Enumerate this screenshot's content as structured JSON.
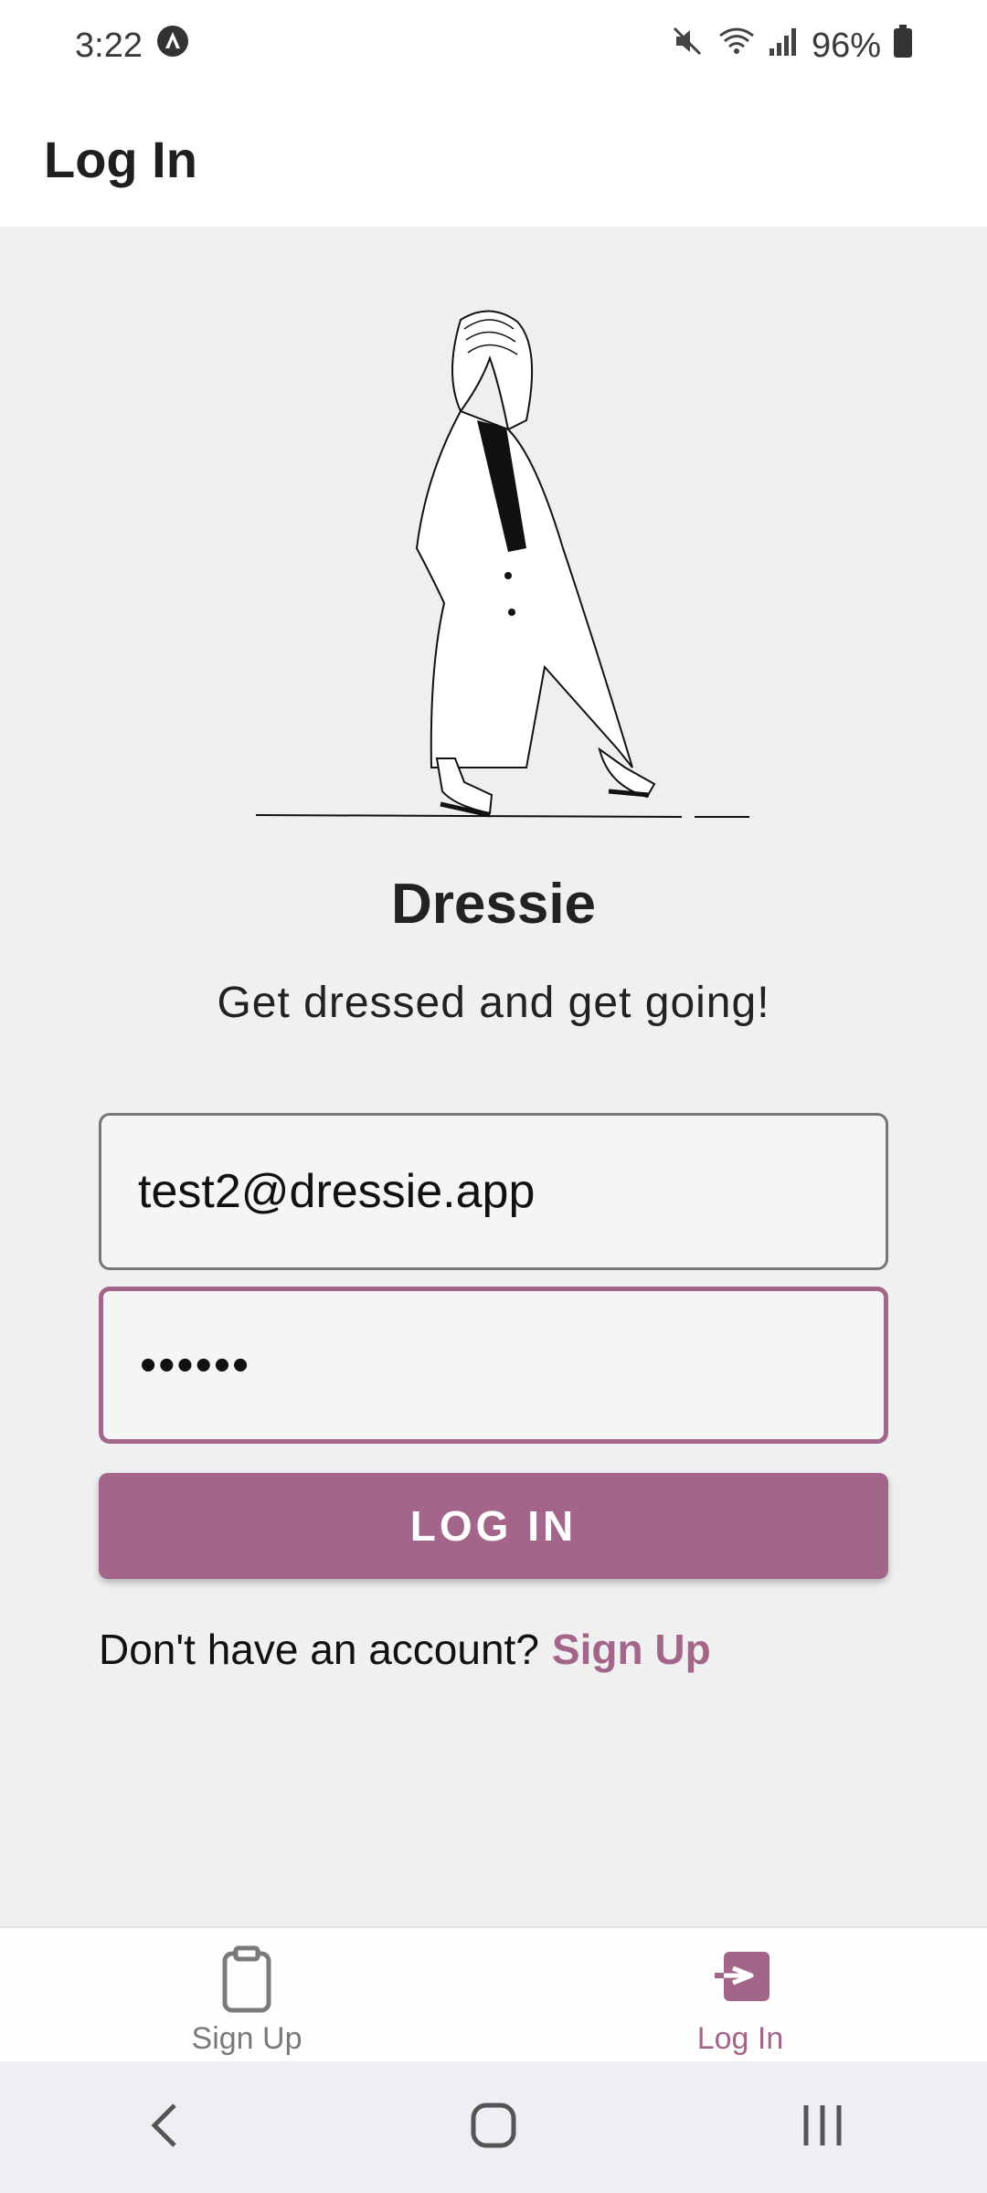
{
  "status_bar": {
    "time": "3:22",
    "battery": "96%",
    "icons": [
      "app-notification-icon",
      "mute-icon",
      "wifi-icon",
      "signal-icon",
      "battery-icon"
    ]
  },
  "header": {
    "title": "Log In"
  },
  "hero": {
    "illustration": "walking-woman-illustration"
  },
  "brand": {
    "name": "Dressie",
    "tagline": "Get dressed and get going!"
  },
  "form": {
    "email_value": "test2@dressie.app",
    "password_value": "••••••",
    "login_label": "LOG IN"
  },
  "signup_prompt": {
    "text": "Don't have an account?",
    "link": "Sign Up"
  },
  "tabs": [
    {
      "label": "Sign Up",
      "icon": "clipboard-icon",
      "active": false
    },
    {
      "label": "Log In",
      "icon": "login-icon",
      "active": true
    }
  ],
  "colors": {
    "accent": "#a3668a",
    "background": "#f0f0f0",
    "inactive": "#7a7a7a"
  }
}
